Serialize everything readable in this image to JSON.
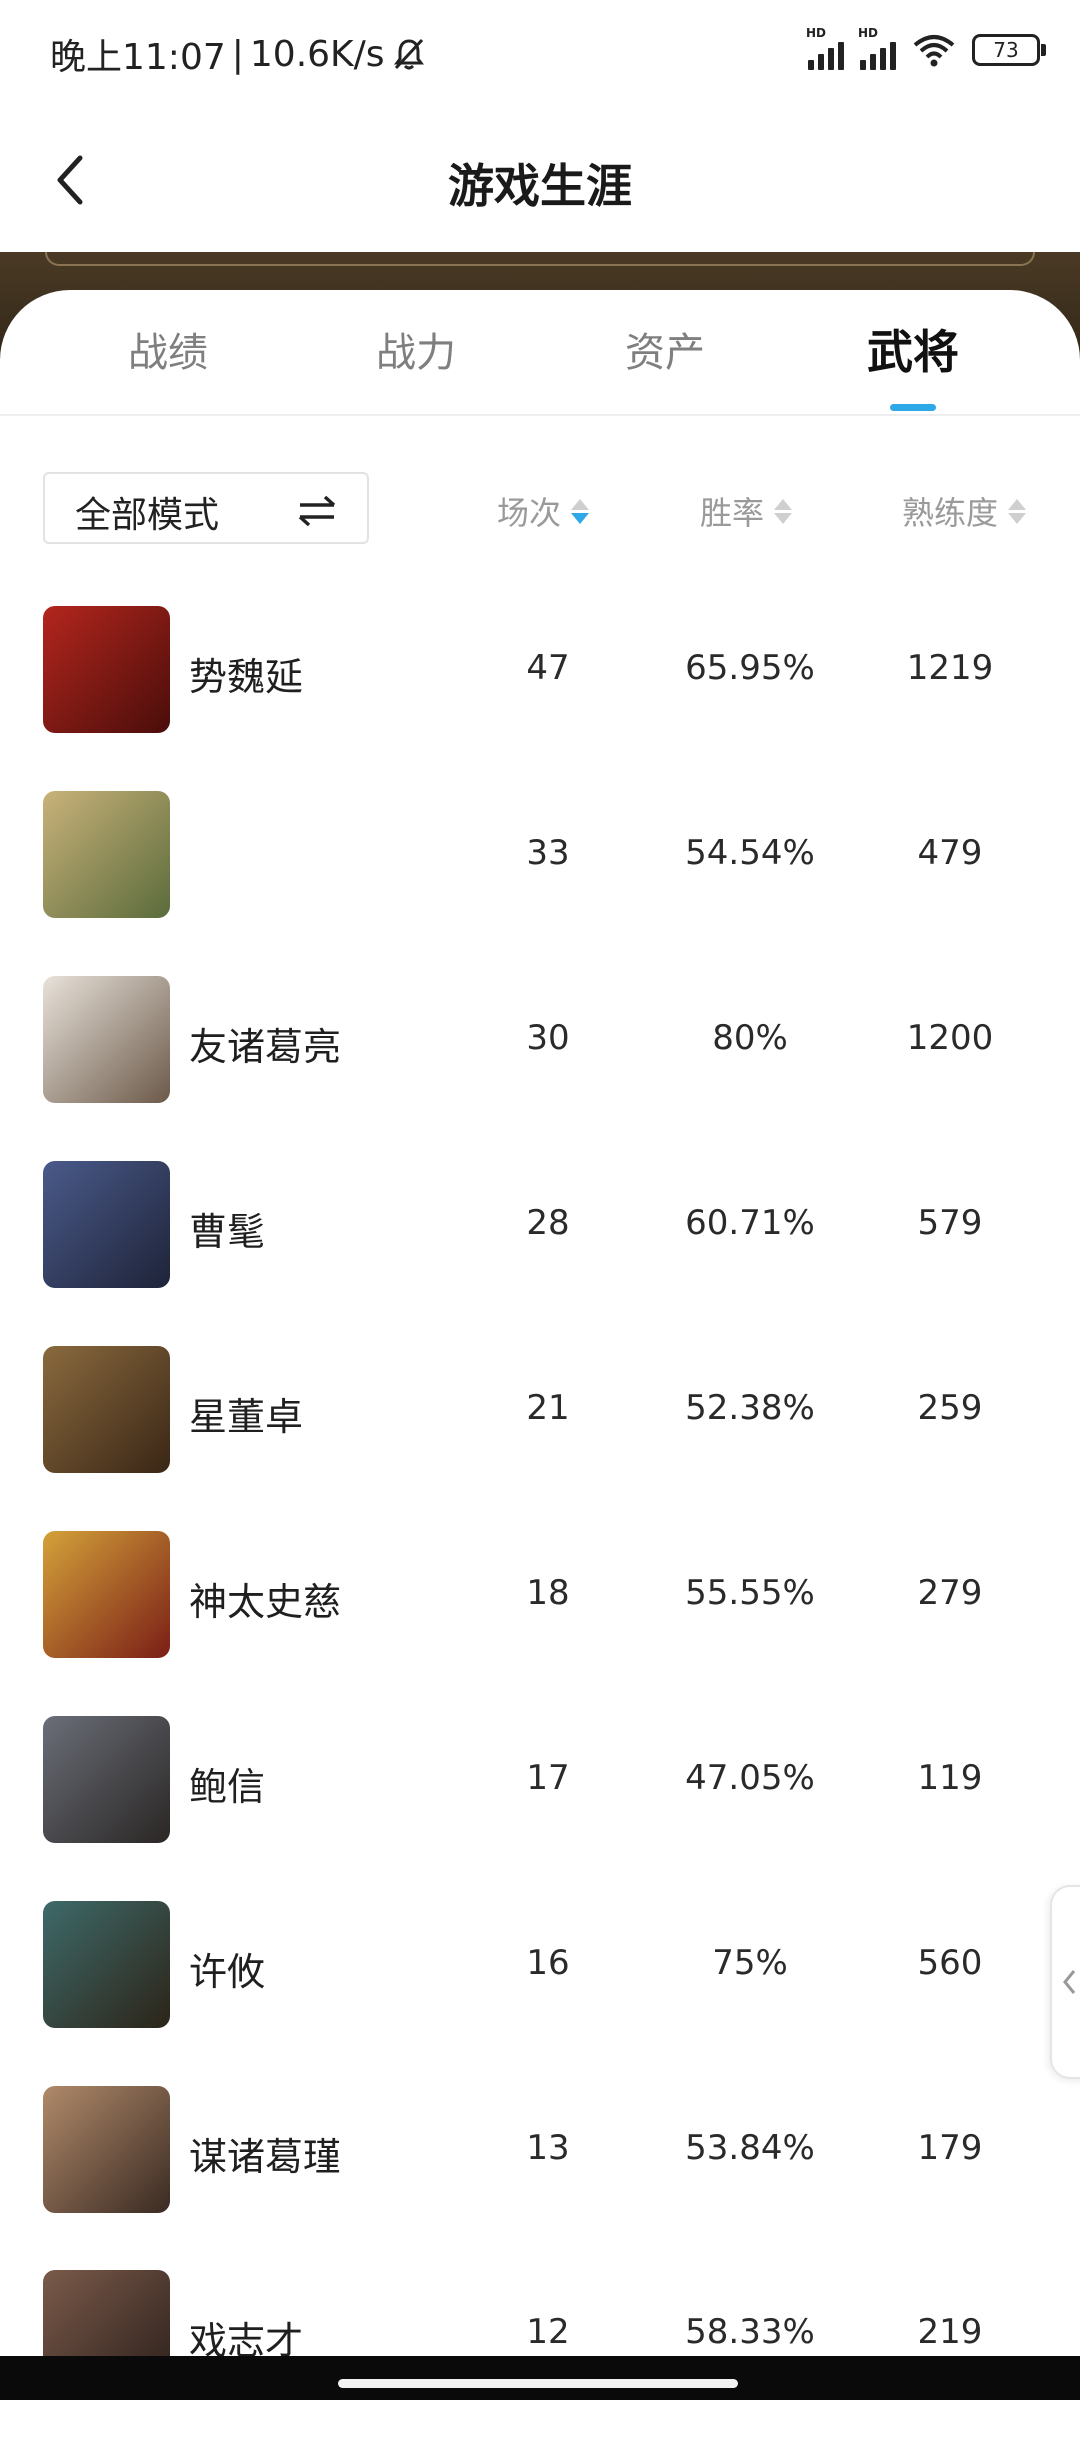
{
  "status_bar": {
    "time": "晚上11:07",
    "separator": "|",
    "speed": "10.6K/s",
    "battery": "73",
    "hd1": "HD",
    "hd2": "HD"
  },
  "header": {
    "title": "游戏生涯"
  },
  "tabs": [
    {
      "label": "战绩",
      "active": false
    },
    {
      "label": "战力",
      "active": false
    },
    {
      "label": "资产",
      "active": false
    },
    {
      "label": "武将",
      "active": true
    }
  ],
  "filter": {
    "mode": "全部模式"
  },
  "columns": {
    "games": "场次",
    "win_rate": "胜率",
    "proficiency": "熟练度"
  },
  "heroes": [
    {
      "name": "势魏延",
      "games": "47",
      "win_rate": "65.95%",
      "proficiency": "1219"
    },
    {
      "name": "",
      "games": "33",
      "win_rate": "54.54%",
      "proficiency": "479"
    },
    {
      "name": "友诸葛亮",
      "games": "30",
      "win_rate": "80%",
      "proficiency": "1200"
    },
    {
      "name": "曹髦",
      "games": "28",
      "win_rate": "60.71%",
      "proficiency": "579"
    },
    {
      "name": "星董卓",
      "games": "21",
      "win_rate": "52.38%",
      "proficiency": "259"
    },
    {
      "name": "神太史慈",
      "games": "18",
      "win_rate": "55.55%",
      "proficiency": "279"
    },
    {
      "name": "鲍信",
      "games": "17",
      "win_rate": "47.05%",
      "proficiency": "119"
    },
    {
      "name": "许攸",
      "games": "16",
      "win_rate": "75%",
      "proficiency": "560"
    },
    {
      "name": "谋诸葛瑾",
      "games": "13",
      "win_rate": "53.84%",
      "proficiency": "179"
    },
    {
      "name": "戏志才",
      "games": "12",
      "win_rate": "58.33%",
      "proficiency": "219"
    }
  ],
  "colors": {
    "accent": "#2fa8e8",
    "banner": "#3a2e1d"
  },
  "icons": {
    "back": "back-arrow-icon",
    "swap": "swap-arrows-icon",
    "sort": "sort-icon",
    "collapse": "chevron-left-icon"
  }
}
